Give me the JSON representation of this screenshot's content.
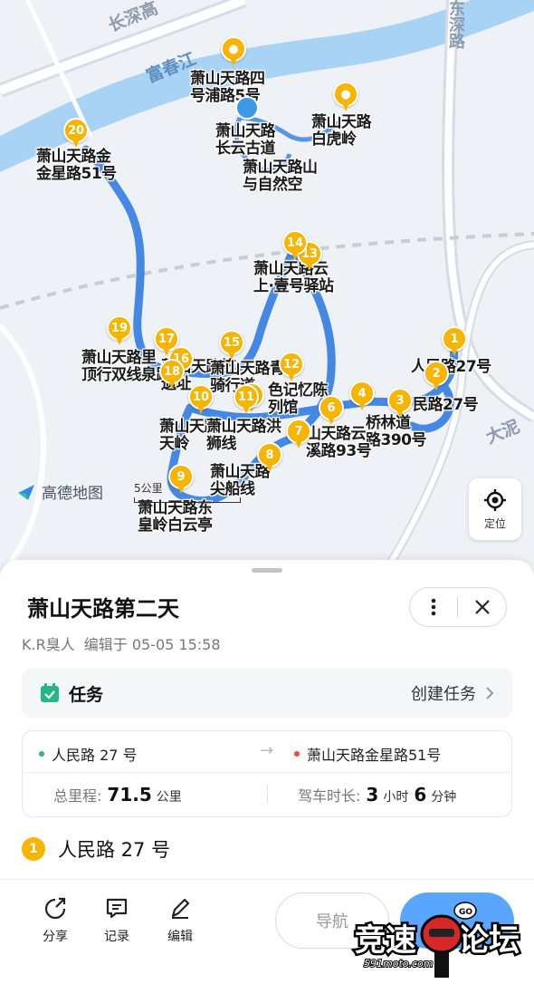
{
  "map": {
    "roads": [
      "长深高",
      "富春江",
      "东深路",
      "大泥"
    ],
    "place_labels": [
      "萧山天路四\n号浦路5号",
      "萧山天路\n长云古道",
      "萧山天路\n白虎岭",
      "萧山天路山\n与自然空",
      "萧山天路金\n金星路51号",
      "萧山天路云\n上·壹号驿站",
      "萧山天路里\n顶行双线泉路",
      "萧山天路笠\n遗址",
      "萧山天路青\n骑行道",
      "色记忆陈\n列馆",
      "人民路27号",
      "民路27号",
      "桥林道\n路390号",
      "萧山天路\n天岭",
      "萧山天路洪\n狮线",
      "山天路云\n溪路93号",
      "萧山天路\n尖船线",
      "萧山天路东\n皇岭白云亭"
    ],
    "pins": [
      "1",
      "2",
      "3",
      "4",
      "5",
      "6",
      "7",
      "8",
      "9",
      "10",
      "11",
      "12",
      "13",
      "14",
      "15",
      "16",
      "17",
      "18",
      "19",
      "20"
    ],
    "logo_text": "高德地图",
    "scale_text": "5公里",
    "locate_label": "定位"
  },
  "route": {
    "title": "萧山天路第二天",
    "author": "K.R臭人",
    "edited_label": "编辑于",
    "edited_time": "05-05 15:58"
  },
  "task": {
    "label": "任务",
    "create_label": "创建任务"
  },
  "summary": {
    "start": "人民路 27 号",
    "end": "萧山天路金星路51号",
    "start_color": "#2bb673",
    "end_color": "#f04848",
    "distance_label": "总里程:",
    "distance_value": "71.5",
    "distance_unit": "公里",
    "time_label": "驾车时长:",
    "hours_value": "3",
    "hours_unit": "小时",
    "minutes_value": "6",
    "minutes_unit": "分钟"
  },
  "stops": [
    {
      "index": "1",
      "name": "人民路 27 号"
    }
  ],
  "toolbar": {
    "share": "分享",
    "record": "记录",
    "edit": "编辑",
    "navigate": "导航"
  },
  "watermark": {
    "text": "竞速论坛",
    "site": "591moto.com"
  }
}
